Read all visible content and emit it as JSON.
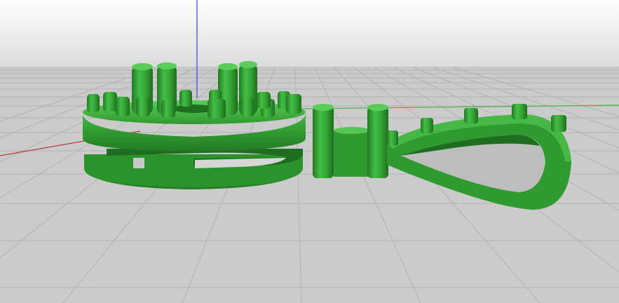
{
  "viewport": {
    "label": "",
    "colors": {
      "sky_top": "#ffffff",
      "sky_horizon": "#d2d2d2",
      "ground": "#c9c9c9",
      "grid_line": "#b4b4b4",
      "x_axis": "#b33a3a",
      "y_axis": "#4fb34f",
      "z_axis": "#4c4cc4",
      "model_base": "#2f9a2f",
      "model_light": "#4cc44c",
      "model_dark": "#1f6e1f",
      "model_hole": "#b9b9b9"
    }
  },
  "model": {
    "name_icon": "green-3d-pendant-model-icon",
    "parts": [
      "ring-base",
      "prong-cluster",
      "bail-connector",
      "teardrop-loop"
    ]
  }
}
